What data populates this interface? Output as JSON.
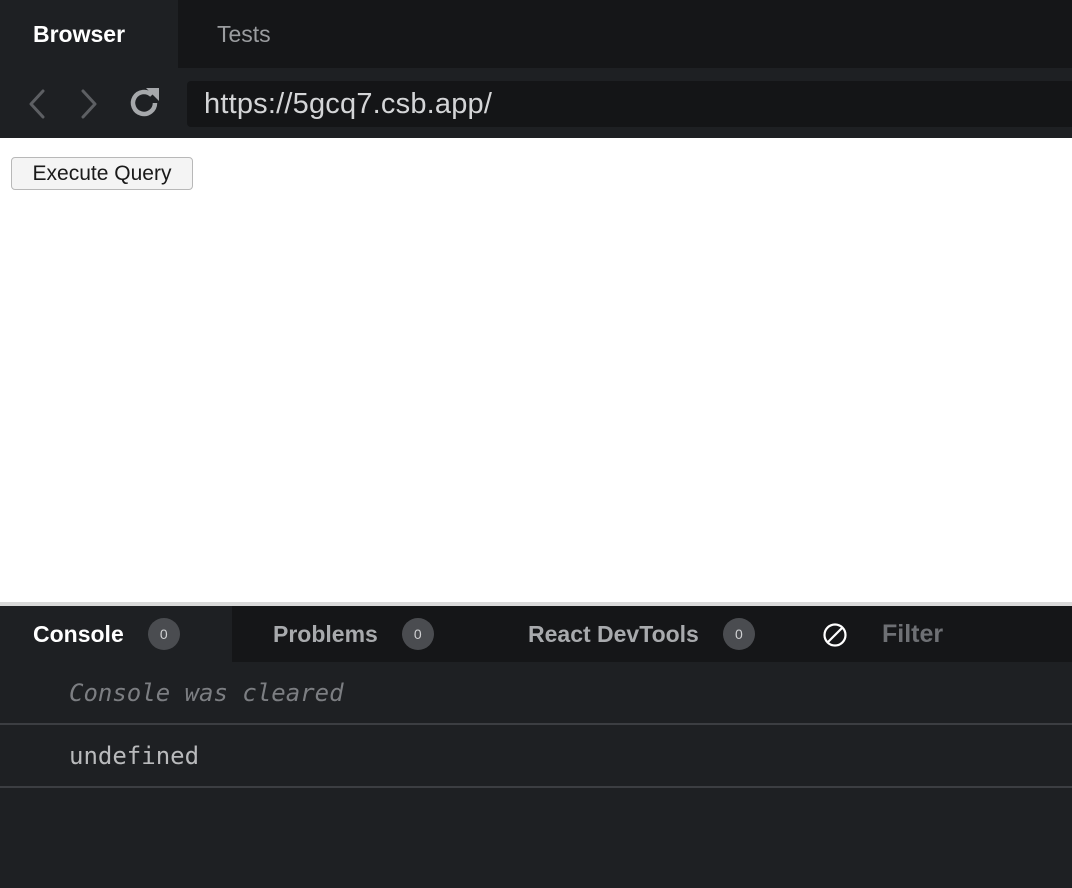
{
  "top_tabs": {
    "browser_label": "Browser",
    "tests_label": "Tests"
  },
  "address_bar": {
    "url": "https://5gcq7.csb.app/"
  },
  "preview": {
    "execute_button_label": "Execute Query"
  },
  "devtools": {
    "tabs": [
      {
        "label": "Console",
        "count": "0"
      },
      {
        "label": "Problems",
        "count": "0"
      },
      {
        "label": "React DevTools",
        "count": "0"
      }
    ],
    "filter_label": "Filter",
    "console_lines": [
      "Console was cleared",
      "undefined"
    ]
  },
  "icons": {
    "back": "chevron-left-icon",
    "forward": "chevron-right-icon",
    "reload": "reload-icon",
    "clear": "clear-console-icon"
  },
  "colors": {
    "panel_bg": "#1e2023",
    "tab_bar_bg": "#151618",
    "badge_bg": "#4a4c50"
  }
}
